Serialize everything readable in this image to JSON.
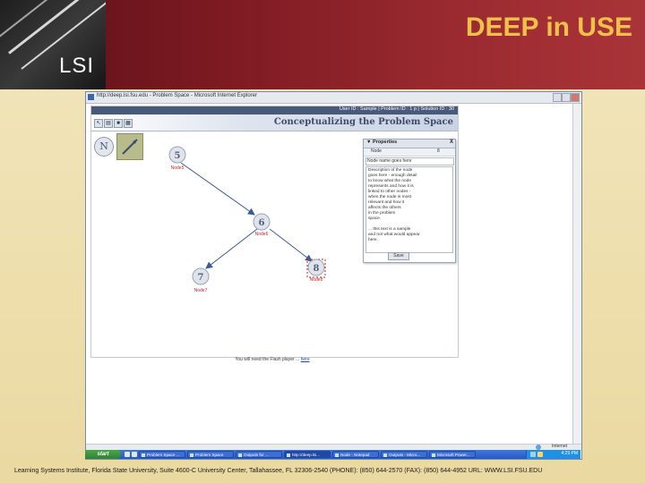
{
  "slide": {
    "title": "DEEP in USE",
    "logo_text": "LSI",
    "footer": "Learning Systems Institute, Florida State University, Suite 4600-C University Center, Tallahassee, FL 32306-2540   (PHONE): (850) 644-2570   (FAX): (850) 644-4952 URL: WWW.LSI.FSU.EDU"
  },
  "browser": {
    "title": "http://deep.lsi.fsu.edu - Problem Space - Microsoft Internet Explorer",
    "status_text": "Internet"
  },
  "app": {
    "info_bar": "User ID : Sample  |  Problem ID : 1 p  |  Solution ID : 30",
    "heading": "Conceptualizing the Problem Space",
    "tools": [
      "select-icon",
      "open-icon",
      "save-icon",
      "print-icon"
    ],
    "mode_button_label": "N",
    "nodes": [
      {
        "number": "5",
        "label": "Node5",
        "selected": false
      },
      {
        "number": "6",
        "label": "Node6",
        "selected": false
      },
      {
        "number": "7",
        "label": "Node7",
        "selected": false
      },
      {
        "number": "8",
        "label": "Node8",
        "selected": true
      }
    ],
    "properties": {
      "title": "Properties",
      "close": "X",
      "row_key": "Node",
      "row_value": "8",
      "name_placeholder": "Node name goes here",
      "description_lines": [
        "Description of the node",
        "goes here - enough detail",
        "to know what the node",
        "represents and how it is",
        "linked to other nodes -",
        "when the node is most",
        "relevant and how it",
        "affects the others",
        "in the problem",
        "space.",
        "",
        "... this text is a sample",
        "and not what would appear",
        "here."
      ],
      "save_label": "Save"
    },
    "footer_text": "You will need the Flash player",
    "footer_link_text": "here"
  },
  "taskbar": {
    "start_label": "start",
    "tasks": [
      "Problem Space ...",
      "Problem Space",
      "Outputs for ...",
      "http://deep.lsi...",
      "Node - Notepad",
      "Outputs - Micro...",
      "Microsoft Power..."
    ],
    "active_index": 3,
    "clock": "4:29 PM"
  },
  "colors": {
    "header_red": "#7e1a22",
    "title_gold": "#f0c04a",
    "node_fill": "#dfe4ec",
    "node_label": "#cc2222",
    "edge": "#3a5a9a"
  }
}
